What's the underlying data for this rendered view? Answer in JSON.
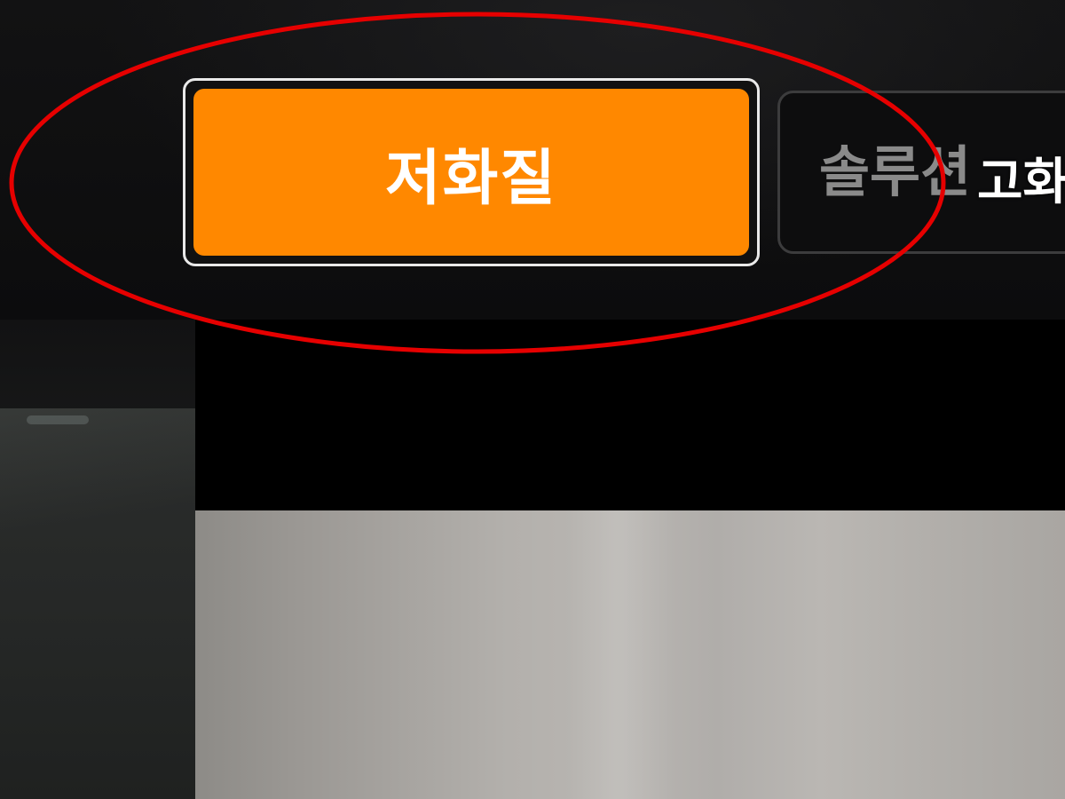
{
  "quality_selector": {
    "low_label": "저화질",
    "solution_label": "솔루션",
    "high_label": "고화"
  },
  "colors": {
    "selected_button": "#ff8800",
    "annotation_circle": "#e60000"
  }
}
